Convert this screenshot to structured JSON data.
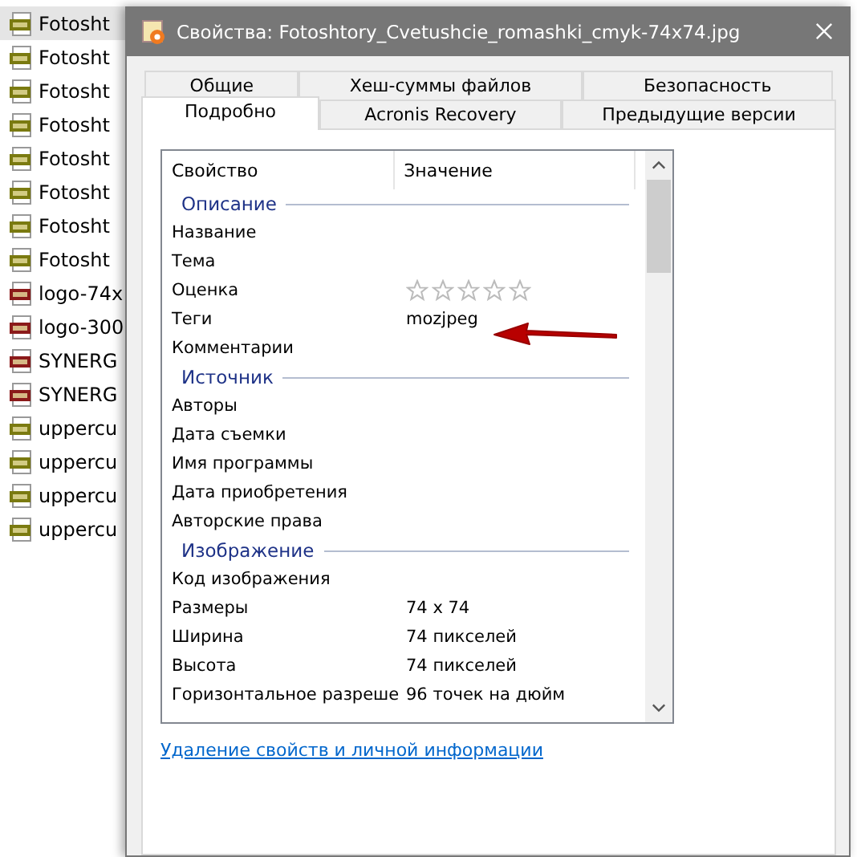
{
  "file_list": [
    {
      "name": "Fotosht",
      "kind": "jpg",
      "selected": true
    },
    {
      "name": "Fotosht",
      "kind": "jpg",
      "selected": false
    },
    {
      "name": "Fotosht",
      "kind": "jpg",
      "selected": false
    },
    {
      "name": "Fotosht",
      "kind": "jpg",
      "selected": false
    },
    {
      "name": "Fotosht",
      "kind": "jpg",
      "selected": false
    },
    {
      "name": "Fotosht",
      "kind": "jpg",
      "selected": false
    },
    {
      "name": "Fotosht",
      "kind": "jpg",
      "selected": false
    },
    {
      "name": "Fotosht",
      "kind": "jpg",
      "selected": false
    },
    {
      "name": "logo-74x",
      "kind": "png",
      "selected": false
    },
    {
      "name": "logo-300",
      "kind": "png",
      "selected": false
    },
    {
      "name": "SYNERG",
      "kind": "png",
      "selected": false
    },
    {
      "name": "SYNERG",
      "kind": "png",
      "selected": false
    },
    {
      "name": "uppercu",
      "kind": "jpg",
      "selected": false
    },
    {
      "name": "uppercu",
      "kind": "jpg",
      "selected": false
    },
    {
      "name": "uppercu",
      "kind": "jpg",
      "selected": false
    },
    {
      "name": "uppercu",
      "kind": "jpg",
      "selected": false
    }
  ],
  "window": {
    "title": "Свойства: Fotoshtory_Cvetushcie_romashki_cmyk-74x74.jpg"
  },
  "tab_rows": [
    [
      {
        "label": "Общие",
        "selected": false
      },
      {
        "label": "Хеш-суммы файлов",
        "selected": false
      },
      {
        "label": "Безопасность",
        "selected": false
      }
    ],
    [
      {
        "label": "Подробно",
        "selected": true
      },
      {
        "label": "Acronis Recovery",
        "selected": false
      },
      {
        "label": "Предыдущие версии",
        "selected": false
      }
    ]
  ],
  "table": {
    "columns": [
      "Свойство",
      "Значение"
    ],
    "groups": [
      {
        "title": "Описание",
        "items": [
          {
            "kind": "text",
            "name": "Название"
          },
          {
            "kind": "text",
            "name": "Тема"
          },
          {
            "kind": "rating",
            "name": "Оценка",
            "stars": 0
          },
          {
            "kind": "text",
            "name": "Теги",
            "value": "mozjpeg"
          },
          {
            "kind": "text",
            "name": "Комментарии"
          }
        ]
      },
      {
        "title": "Источник",
        "items": [
          {
            "kind": "text",
            "name": "Авторы"
          },
          {
            "kind": "text",
            "name": "Дата съемки"
          },
          {
            "kind": "text",
            "name": "Имя программы"
          },
          {
            "kind": "text",
            "name": "Дата приобретения"
          },
          {
            "kind": "text",
            "name": "Авторские права"
          }
        ]
      },
      {
        "title": "Изображение",
        "items": [
          {
            "kind": "text",
            "name": "Код изображения"
          },
          {
            "kind": "text",
            "name": "Размеры",
            "value": "74 x 74"
          },
          {
            "kind": "text",
            "name": "Ширина",
            "value": "74 пикселей"
          },
          {
            "kind": "text",
            "name": "Высота",
            "value": "74 пикселей"
          },
          {
            "kind": "text",
            "name": "Горизонтальное разреше",
            "value": "96 точек на дюйм"
          }
        ]
      }
    ]
  },
  "link": "Удаление свойств и личной информации"
}
